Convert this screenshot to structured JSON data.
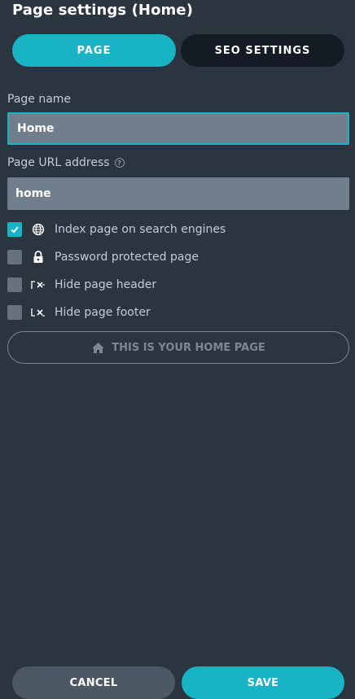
{
  "title": "Page settings (Home)",
  "tabs": [
    {
      "label": "PAGE",
      "active": true
    },
    {
      "label": "SEO SETTINGS",
      "active": false
    }
  ],
  "page_name": {
    "label": "Page name",
    "value": "Home"
  },
  "page_url": {
    "label": "Page URL address",
    "value": "home",
    "help_icon": "question-circle-icon"
  },
  "options": [
    {
      "label": "Index page on search engines",
      "checked": true,
      "icon": "globe-icon"
    },
    {
      "label": "Password protected page",
      "checked": false,
      "icon": "lock-icon"
    },
    {
      "label": "Hide page header",
      "checked": false,
      "icon": "header-hide-icon"
    },
    {
      "label": "Hide page footer",
      "checked": false,
      "icon": "footer-hide-icon"
    }
  ],
  "home_button": {
    "label": "THIS IS YOUR HOME PAGE",
    "icon": "home-icon"
  },
  "footer": {
    "cancel_label": "CANCEL",
    "save_label": "SAVE"
  },
  "colors": {
    "accent": "#19b3c6",
    "background": "#2b3540",
    "input": "#717f8c",
    "dark_tab": "#141b24"
  }
}
